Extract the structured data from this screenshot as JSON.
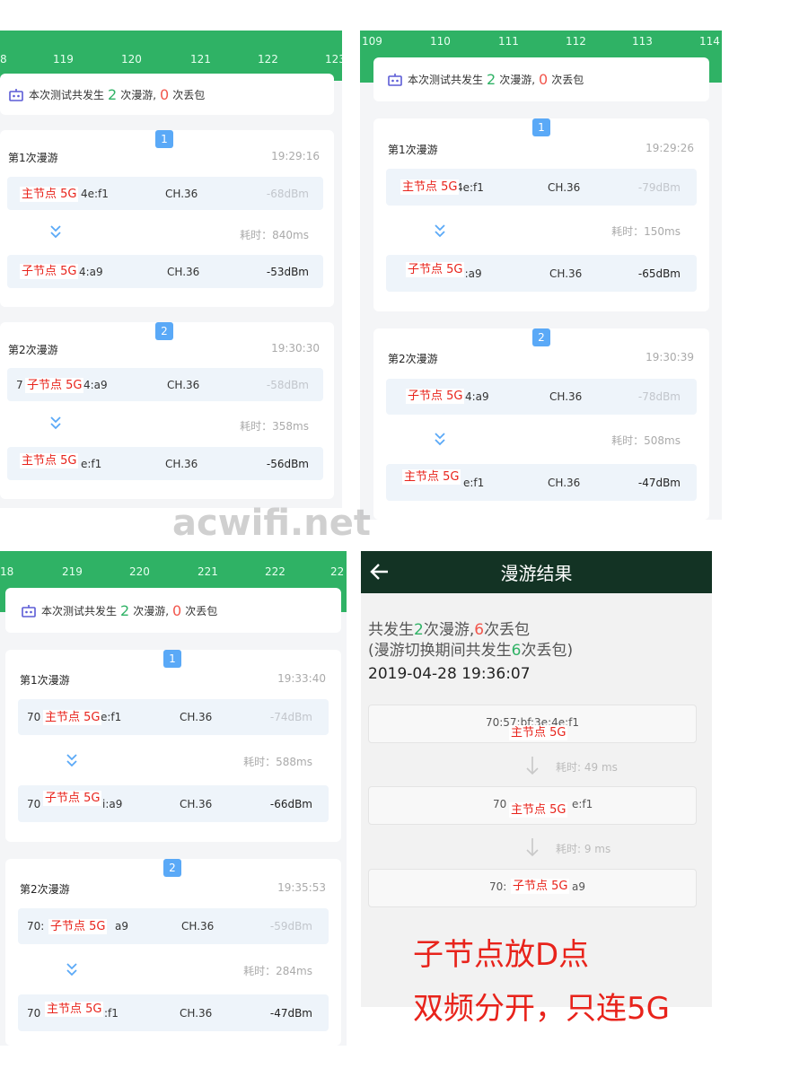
{
  "summary": {
    "prefix": "本次测试共发生",
    "roams": "2",
    "mid": "次漫游,",
    "lost": "0",
    "suffix": "次丢包"
  },
  "common": {
    "duration_label": "耗时：",
    "channel": "CH.36"
  },
  "labels": {
    "main": "主节点 5G",
    "sub": "子节点 5G"
  },
  "panels": [
    {
      "ticks": [
        "8",
        "119",
        "120",
        "121",
        "122",
        "123"
      ],
      "events": [
        {
          "badge": "1",
          "title": "第1次漫游",
          "time": "19:29:16",
          "from": {
            "mac": "4e:f1",
            "dbm": "-68dBm",
            "label": "主节点 5G"
          },
          "duration": "840ms",
          "to": {
            "mac": "4:a9",
            "dbm": "-53dBm",
            "label": "子节点 5G"
          }
        },
        {
          "badge": "2",
          "title": "第2次漫游",
          "time": "19:30:30",
          "from": {
            "mac": "7",
            "mac2": "4:a9",
            "dbm": "-58dBm",
            "label": "子节点 5G"
          },
          "duration": "358ms",
          "to": {
            "mac": "e:f1",
            "dbm": "-56dBm",
            "label": "主节点 5G"
          }
        }
      ]
    },
    {
      "ticks": [
        "109",
        "110",
        "111",
        "112",
        "113",
        "114"
      ],
      "events": [
        {
          "badge": "1",
          "title": "第1次漫游",
          "time": "19:29:26",
          "from": {
            "mac": "4e:f1",
            "dbm": "-79dBm",
            "label": "主节点 5G"
          },
          "duration": "150ms",
          "to": {
            "mac": "4:a9",
            "dbm": "-65dBm",
            "label": "子节点 5G"
          }
        },
        {
          "badge": "2",
          "title": "第2次漫游",
          "time": "19:30:39",
          "from": {
            "mac": "4:a9",
            "dbm": "-78dBm",
            "label": "子节点 5G"
          },
          "duration": "508ms",
          "to": {
            "mac": "e:f1",
            "dbm": "-47dBm",
            "label": "主节点 5G"
          }
        }
      ]
    },
    {
      "ticks": [
        "18",
        "219",
        "220",
        "221",
        "222",
        "22"
      ],
      "events": [
        {
          "badge": "1",
          "title": "第1次漫游",
          "time": "19:33:40",
          "from": {
            "mac": "70",
            "mac2": "e:f1",
            "dbm": "-74dBm",
            "label": "主节点 5G"
          },
          "duration": "588ms",
          "to": {
            "mac": "70",
            "mac2": "i:a9",
            "dbm": "-66dBm",
            "label": "子节点 5G"
          }
        },
        {
          "badge": "2",
          "title": "第2次漫游",
          "time": "19:35:53",
          "from": {
            "mac": "70:",
            "mac2": "a9",
            "dbm": "-59dBm",
            "label": "子节点 5G"
          },
          "duration": "284ms",
          "to": {
            "mac": "70",
            "mac2": ":f1",
            "dbm": "-47dBm",
            "label": "主节点 5G"
          }
        }
      ]
    }
  ],
  "result": {
    "title": "漫游结果",
    "line1_a": "共发生",
    "line1_roams": "2",
    "line1_b": "次漫游,",
    "line1_lost": "6",
    "line1_c": "次丢包",
    "line2_a": "(漫游切换期间共发生",
    "line2_lost": "6",
    "line2_b": "次丢包)",
    "datetime": "2019-04-28 19:36:07",
    "box1_mac": "70:57:bf:3e:4e:f1",
    "box1_label": "主节点 5G",
    "dur1": "耗时: 49 ms",
    "box2_mac": "70",
    "box2_mac2": "e:f1",
    "box2_label": "主节点 5G",
    "dur2": "耗时: 9 ms",
    "box3_mac": "70:",
    "box3_mac2": "a9",
    "box3_label": "子节点 5G"
  },
  "watermark": "acwifi.net",
  "caption": {
    "line1": "子节点放D点",
    "line2": "双频分开，只连5G"
  },
  "colors": {
    "green": "#2fb265",
    "red": "#f2564c",
    "blue": "#5aa9f7",
    "dark_header": "#133324",
    "caption_red": "#e8231b"
  }
}
